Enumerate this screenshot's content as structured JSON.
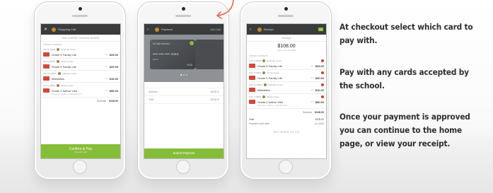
{
  "captions": [
    "At checkout select which card to pay with.",
    "Pay with any cards accepted by the school.",
    "Once your payment is approved you can continue to the home page, or view your receipt."
  ],
  "phone1": {
    "app_title": "Shopping Cart",
    "subtitle": "EMI CLASSIC SCHOOL BOOKS",
    "section_label": "ORDER SUMMARY",
    "orders": [
      {
        "who_date": "10/7 6:54PM",
        "who": "Charlotte Jones",
        "item": "Grade 5 Family Life",
        "qty": "x1",
        "price": "$25.00",
        "sub": ""
      },
      {
        "who_date": "10/7 6:54PM",
        "who": "James Jones",
        "item": "Grade 5 Family Life",
        "qty": "x1",
        "price": "$20.00",
        "sub": ""
      },
      {
        "who_date": "10/7 12:49PM",
        "who": "Charlotte Jones",
        "item": "Mathletics",
        "qty": "x1",
        "price": "$10.00",
        "sub": ""
      },
      {
        "who_date": "10/7 1:28PM",
        "who": "James Jones",
        "item": "Grade 2 Author Visit",
        "qty": "x1",
        "price": "$50.00",
        "sub": "Excursion reading - Guardian form"
      }
    ],
    "subtotal_label": "Subtotal",
    "subtotal_value": "$108.00",
    "button_label": "Confirm & Pay",
    "button_sub": "Pay with card"
  },
  "phone2": {
    "app_title": "Payment",
    "right_label": "Add Card",
    "card_holder": "Mr Sam Harrison",
    "card_number": "•••• •••• •••• 4444",
    "card_expiry": "09/18",
    "card_brand": "VISA",
    "summary": [
      {
        "label": "Subtotal",
        "value": "$108.00"
      },
      {
        "label": "Total",
        "value": "$108.00"
      }
    ],
    "button_label": "Submit Payment"
  },
  "phone3": {
    "app_title": "Receipt",
    "subtitle": "Receipt",
    "total_big": "$108.00",
    "total_date": "Paid - Jun 12, 2015",
    "section_label": "ORDER SUMMARY",
    "orders": [
      {
        "who_date": "10/7 6:54PM",
        "who": "Charlotte Jones",
        "item": "Grade 5 Family Life",
        "qty": "x1",
        "price": "$25.00",
        "sub": ""
      },
      {
        "who_date": "10/7 6:54PM",
        "who": "James Jones",
        "item": "Grade 5 Family Life",
        "qty": "x1",
        "price": "$20.00",
        "sub": ""
      },
      {
        "who_date": "10/7 12:49PM",
        "who": "Charlotte Jones",
        "item": "Mathletics",
        "qty": "x1",
        "price": "$10.00",
        "sub": ""
      },
      {
        "who_date": "10/7 1:28PM",
        "who": "James Jones",
        "item": "Grade 2 Author Visit",
        "qty": "x1",
        "price": "$50.00",
        "sub": "Excursion reading - Guardian form"
      }
    ],
    "subtotal_label": "Subtotal",
    "subtotal_value": "$108.00",
    "totals": [
      {
        "label": "Total",
        "value": "$108.00"
      },
      {
        "label": "Payment card used",
        "value": "•••• 4444"
      }
    ],
    "order_number": "REF ORDER 123 123"
  },
  "colors": {
    "accent_green": "#86bd38",
    "app_bar": "#3a3b3d",
    "arrow": "#e06a4f",
    "delete_red": "#c0392b"
  },
  "icons": [
    "back-arrow-icon",
    "close-icon",
    "avatar-icon",
    "check-icon",
    "selected-card-icon",
    "delete-icon",
    "pointer-arrow-icon"
  ]
}
